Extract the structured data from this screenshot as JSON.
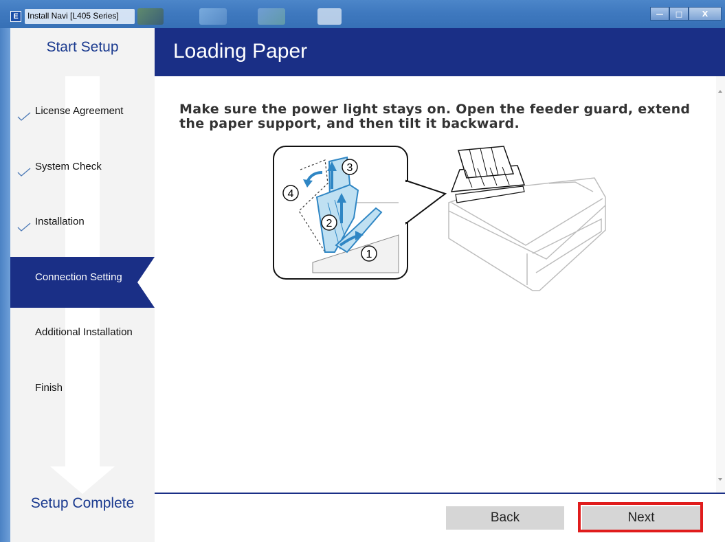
{
  "window": {
    "icon_letter": "E",
    "title": "Install Navi [L405 Series]",
    "controls": {
      "minimize": "—",
      "maximize": "□",
      "close": "X"
    }
  },
  "sidebar": {
    "start_label": "Start Setup",
    "complete_label": "Setup Complete",
    "items": [
      {
        "label": "License Agreement",
        "checked": true,
        "active": false
      },
      {
        "label": "System Check",
        "checked": true,
        "active": false
      },
      {
        "label": "Installation",
        "checked": true,
        "active": false
      },
      {
        "label": "Connection Setting",
        "checked": false,
        "active": true
      },
      {
        "label": "Additional Installation",
        "checked": false,
        "active": false
      },
      {
        "label": "Finish",
        "checked": false,
        "active": false
      }
    ]
  },
  "main": {
    "title": "Loading Paper",
    "instruction": "Make sure the power light stays on. Open the feeder guard, extend the paper support, and then tilt it backward.",
    "illustration": {
      "steps": [
        "1",
        "2",
        "3",
        "4"
      ],
      "accent_color": "#2f86c4",
      "fill_color": "#bfe0f2"
    }
  },
  "footer": {
    "back_label": "Back",
    "next_label": "Next",
    "highlight_color": "#e01c1c"
  },
  "colors": {
    "brand_navy": "#1a2f86",
    "title_bar": "#3f79bf",
    "sidebar_bg": "#f3f3f3",
    "button_bg": "#d6d6d6"
  }
}
